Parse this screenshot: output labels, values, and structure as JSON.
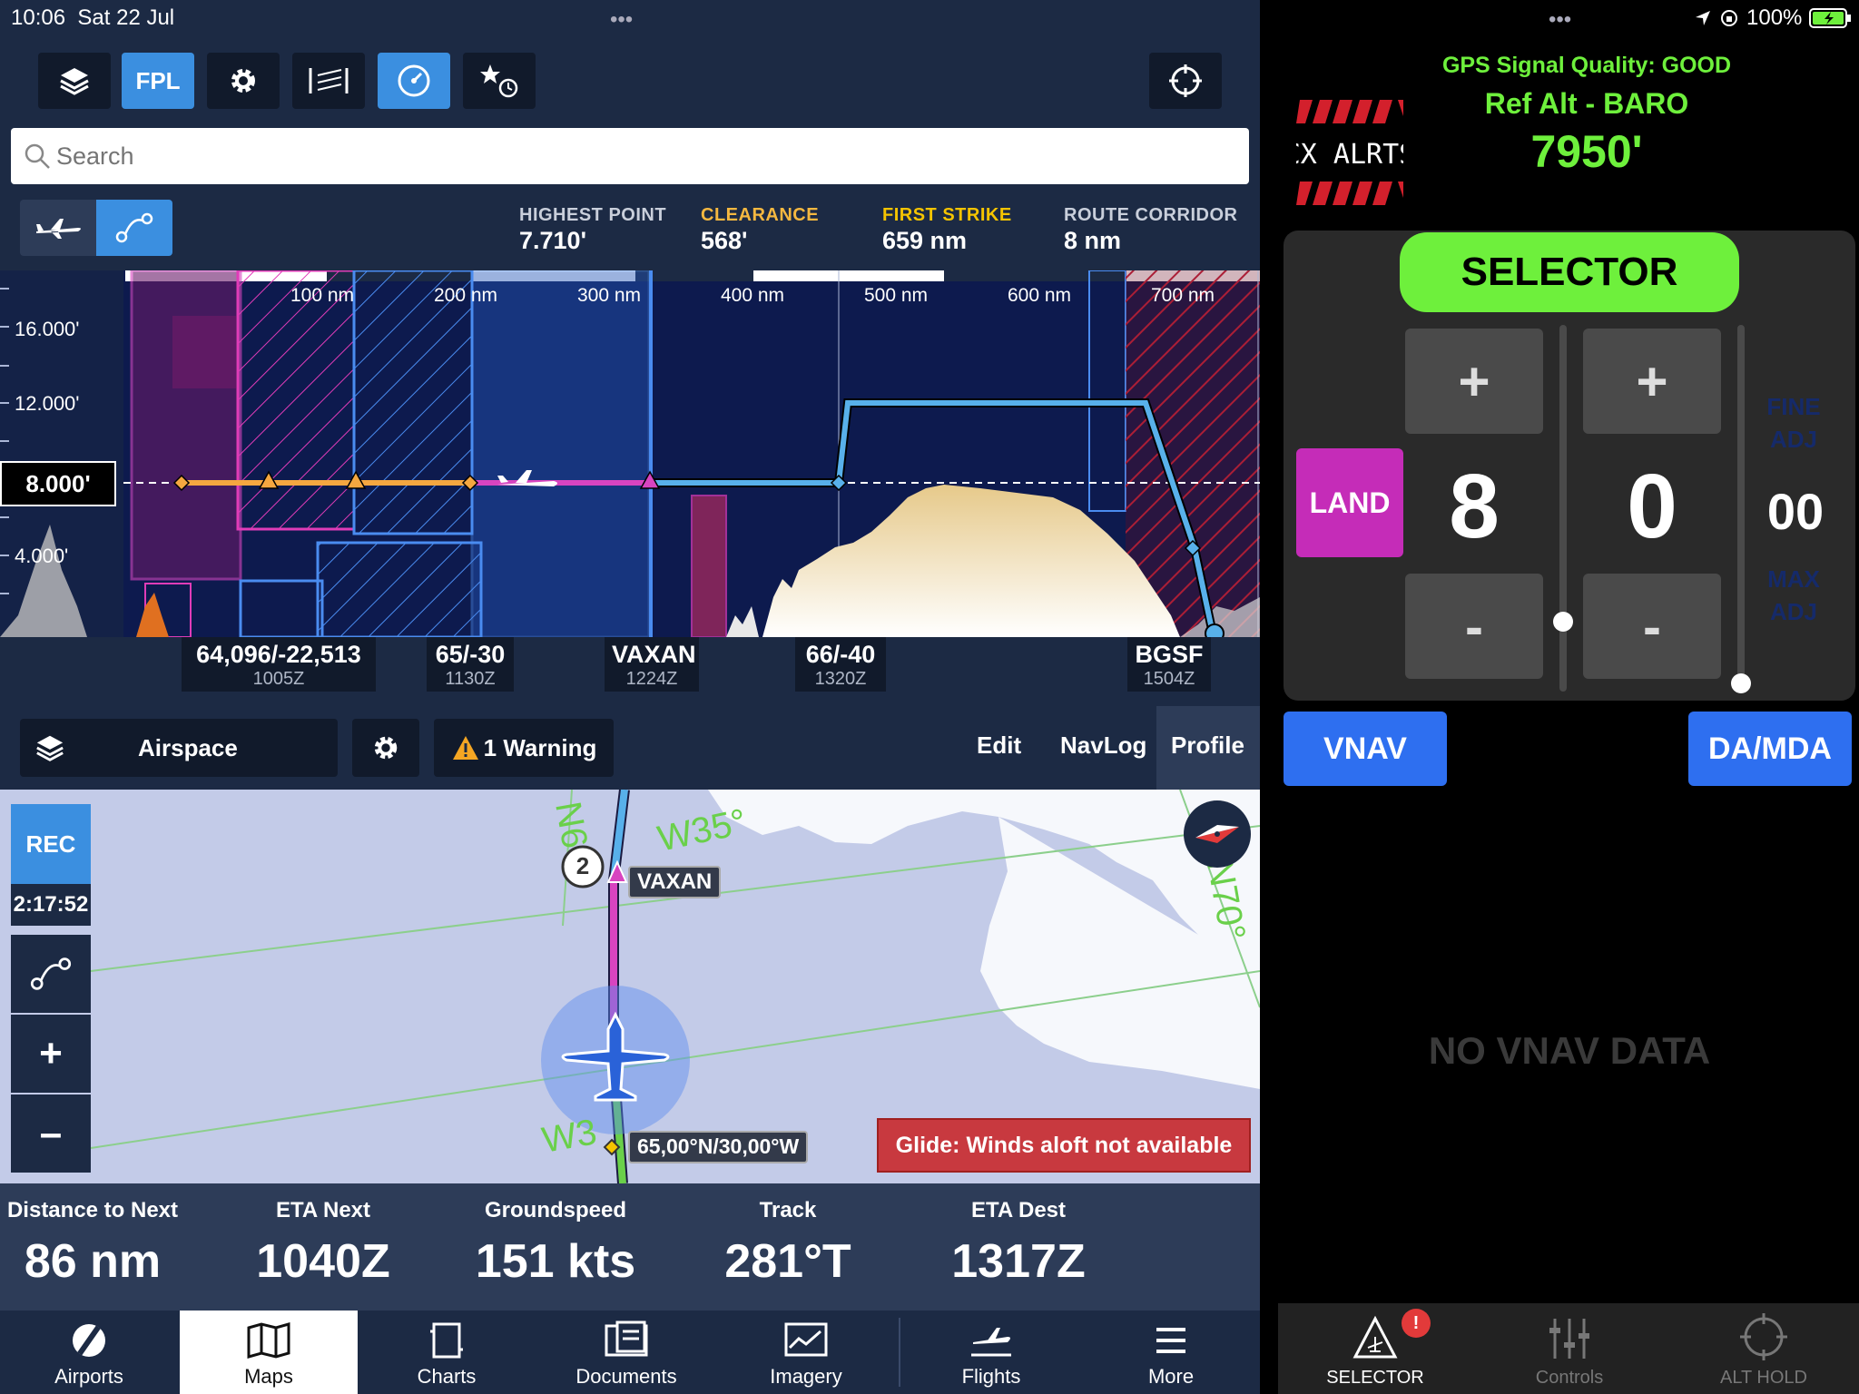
{
  "status": {
    "time": "10:06",
    "date": "Sat 22 Jul",
    "battery": "100%"
  },
  "toolbar": {
    "fpl_label": "FPL"
  },
  "search": {
    "placeholder": "Search"
  },
  "profile_stats": [
    {
      "label": "HIGHEST POINT",
      "value": "7.710'",
      "color": "#c9cfdb"
    },
    {
      "label": "CLEARANCE",
      "value": "568'",
      "color": "#f5b840"
    },
    {
      "label": "FIRST STRIKE",
      "value": "659 nm",
      "color": "#f5c400"
    },
    {
      "label": "ROUTE CORRIDOR",
      "value": "8 nm",
      "color": "#c9cfdb"
    }
  ],
  "profile": {
    "distance_ticks": [
      "100 nm",
      "200 nm",
      "300 nm",
      "400 nm",
      "500 nm",
      "600 nm",
      "700 nm"
    ],
    "alt_ticks": [
      "16.000'",
      "12.000'",
      "4.000'"
    ],
    "current_alt": "8.000'",
    "waypoints": [
      {
        "name": "64,096/-22,513",
        "time": "1005Z"
      },
      {
        "name": "65/-30",
        "time": "1130Z"
      },
      {
        "name": "VAXAN",
        "time": "1224Z"
      },
      {
        "name": "66/-40",
        "time": "1320Z"
      },
      {
        "name": "BGSF",
        "time": "1504Z"
      }
    ]
  },
  "profile_bar": {
    "layer_label": "Airspace",
    "warning_label": "1 Warning",
    "edit": "Edit",
    "navlog": "NavLog",
    "profile": "Profile"
  },
  "map": {
    "rec": "REC",
    "timer": "2:17:52",
    "waypoint_label": "VAXAN",
    "waypoint_number": "2",
    "coord_label": "65,00°N/30,00°W",
    "grid_labels": [
      "W35°",
      "N70°",
      "W3",
      "N6"
    ],
    "glide_warning": "Glide: Winds aloft not available"
  },
  "info_bar": [
    {
      "label": "Distance to Next",
      "value": "86 nm"
    },
    {
      "label": "ETA Next",
      "value": "1040Z"
    },
    {
      "label": "Groundspeed",
      "value": "151 kts"
    },
    {
      "label": "Track",
      "value": "281°T"
    },
    {
      "label": "ETA Dest",
      "value": "1317Z"
    }
  ],
  "bottom_nav": [
    {
      "label": "Airports",
      "icon": "airport-icon"
    },
    {
      "label": "Maps",
      "icon": "map-icon"
    },
    {
      "label": "Charts",
      "icon": "charts-icon"
    },
    {
      "label": "Documents",
      "icon": "documents-icon"
    },
    {
      "label": "Imagery",
      "icon": "imagery-icon"
    },
    {
      "label": "Flights",
      "icon": "flights-icon"
    },
    {
      "label": "More",
      "icon": "menu-icon"
    }
  ],
  "right": {
    "gps_quality": "GPS Signal Quality: GOOD",
    "ref_alt": "Ref Alt - BARO",
    "alt_value": "7950'",
    "logo": "CX ALRTS",
    "selector": "SELECTOR",
    "land": "LAND",
    "digit1": "8",
    "digit2": "0",
    "digit3": "00",
    "plus": "+",
    "minus": "-",
    "fine_adj": "FINE ADJ",
    "max_adj": "MAX ADJ",
    "vnav": "VNAV",
    "da_mda": "DA/MDA",
    "no_vnav": "NO VNAV DATA",
    "nav": [
      {
        "label": "SELECTOR",
        "icon": "warning-icon"
      },
      {
        "label": "Controls",
        "icon": "sliders-icon"
      },
      {
        "label": "ALT HOLD",
        "icon": "crosshair-icon"
      }
    ],
    "badge": "!"
  },
  "colors": {
    "accent": "#3b8fe0",
    "green": "#6ef03c",
    "magenta": "#c52cb8",
    "warn_red": "#c8393f"
  }
}
